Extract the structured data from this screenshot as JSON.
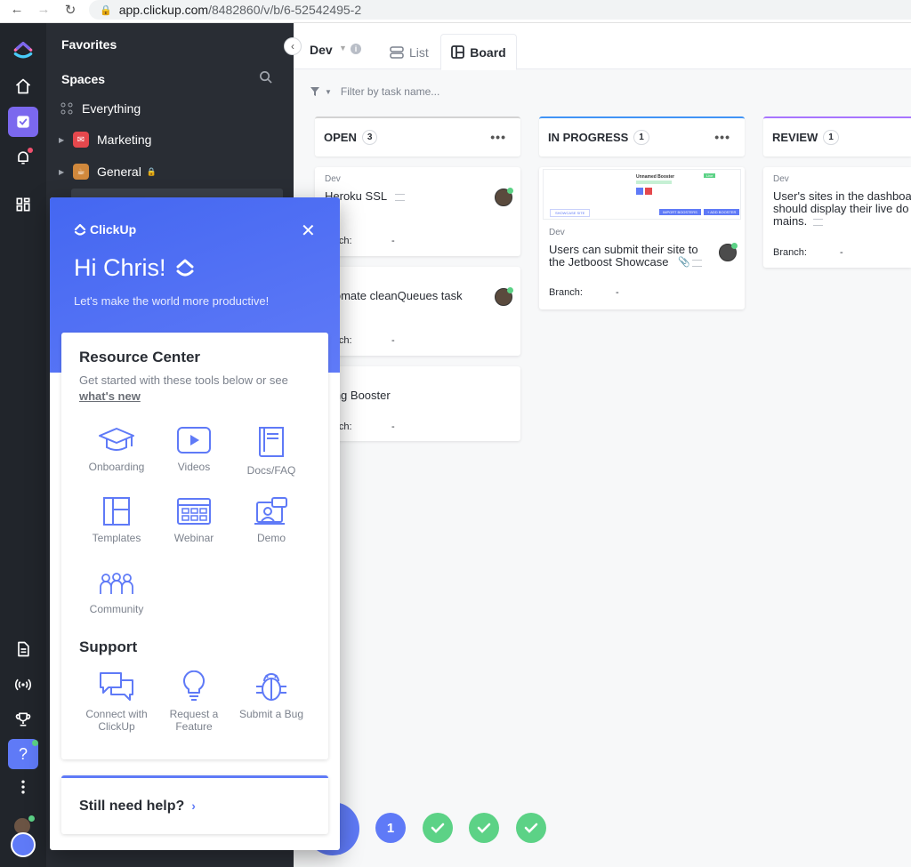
{
  "browser": {
    "url_host": "app.clickup.com",
    "url_path": "/8482860/v/b/6-52542495-2"
  },
  "sidebar": {
    "favorites_label": "Favorites",
    "spaces_label": "Spaces",
    "everything_label": "Everything",
    "spaces": [
      {
        "name": "Marketing",
        "color": "#e5484d",
        "icon": "megaphone-icon"
      },
      {
        "name": "General",
        "color": "#d0883c",
        "icon": "coffee-icon",
        "locked": true
      }
    ]
  },
  "header": {
    "space": "Dev",
    "tabs": [
      {
        "label": "List",
        "icon": "list-icon"
      },
      {
        "label": "Board",
        "icon": "board-icon",
        "active": true
      }
    ]
  },
  "filter": {
    "placeholder": "Filter by task name..."
  },
  "board": {
    "columns": [
      {
        "name": "OPEN",
        "count": "3",
        "color": "#d3d3d3",
        "cards": [
          {
            "list": "Dev",
            "title": "Heroku SSL",
            "branch_label": "ranch:",
            "branch_value": "-"
          },
          {
            "list": "",
            "title": "utomate cleanQueues task",
            "branch_label": "ranch:",
            "branch_value": "-"
          },
          {
            "list": "",
            "title": "rting Booster",
            "branch_label": "ranch:",
            "branch_value": "-"
          }
        ]
      },
      {
        "name": "IN PROGRESS",
        "count": "1",
        "color": "#4194f6",
        "cards": [
          {
            "list": "Dev",
            "title_line1": "Users can submit their site to",
            "title_line2": "the Jetboost Showcase",
            "branch_label": "Branch:",
            "branch_value": "-",
            "thumb": {
              "title": "Unnamed Booster",
              "badge": "Live",
              "left_btn": "SHOWCASE SITE",
              "btn_a": "IMPORT BOOSTERS",
              "btn_b": "+ ADD BOOSTER"
            }
          }
        ]
      },
      {
        "name": "REVIEW",
        "count": "1",
        "color": "#a875ff",
        "cards": [
          {
            "list": "Dev",
            "title_line1": "User's sites in the dashboa",
            "title_line2": "should display their live do",
            "title_line3": "mains.",
            "branch_label": "Branch:",
            "branch_value": "-"
          }
        ]
      }
    ]
  },
  "panel": {
    "brand": "ClickUp",
    "greeting": "Hi Chris!",
    "subtitle": "Let's make the world more productive!",
    "resource_title": "Resource Center",
    "resource_desc": "Get started with these tools below or see",
    "whats_new": "what's new",
    "tools": [
      {
        "label": "Onboarding",
        "icon": "graduation-cap-icon"
      },
      {
        "label": "Videos",
        "icon": "play-icon"
      },
      {
        "label": "Docs/FAQ",
        "icon": "book-icon"
      },
      {
        "label": "Templates",
        "icon": "template-icon"
      },
      {
        "label": "Webinar",
        "icon": "webinar-icon"
      },
      {
        "label": "Demo",
        "icon": "demo-icon"
      },
      {
        "label": "Community",
        "icon": "community-icon"
      }
    ],
    "support_title": "Support",
    "support": [
      {
        "label_line1": "Connect with",
        "label_line2": "ClickUp",
        "icon": "chat-icon"
      },
      {
        "label_line1": "Request a",
        "label_line2": "Feature",
        "icon": "lightbulb-icon"
      },
      {
        "label_line1": "Submit a Bug",
        "label_line2": "",
        "icon": "bug-icon"
      }
    ],
    "help": "Still need help?"
  },
  "progress": {
    "current_step": "1",
    "steps_done": 3
  },
  "colors": {
    "accent": "#7b68ee",
    "panel_blue": "#5f7af7",
    "success": "#5cd286"
  }
}
